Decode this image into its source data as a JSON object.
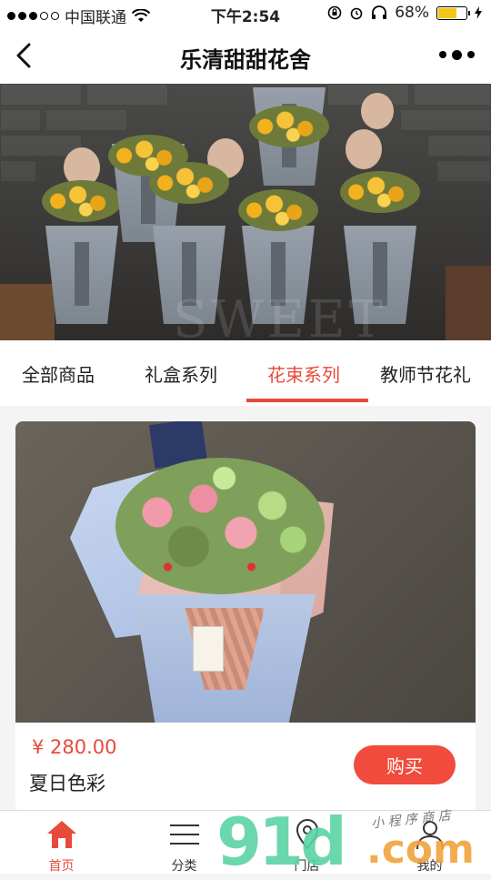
{
  "status_bar": {
    "carrier": "中国联通",
    "time": "下午2:54",
    "battery": "68%",
    "battery_level": 0.68
  },
  "nav": {
    "title": "乐清甜甜花舍"
  },
  "banner": {
    "watermark": "SWEET"
  },
  "tabs": [
    {
      "label": "全部商品",
      "active": false
    },
    {
      "label": "礼盒系列",
      "active": false
    },
    {
      "label": "花束系列",
      "active": true
    },
    {
      "label": "教师节花礼",
      "active": false
    }
  ],
  "product": {
    "price": "¥ 280.00",
    "name": "夏日色彩",
    "buy_label": "购买"
  },
  "tabbar": [
    {
      "label": "首页",
      "icon": "home-icon",
      "active": true
    },
    {
      "label": "分类",
      "icon": "menu-icon",
      "active": false
    },
    {
      "label": "门店",
      "icon": "location-icon",
      "active": false
    },
    {
      "label": "我的",
      "icon": "user-icon",
      "active": false
    }
  ],
  "watermark_logo": {
    "text_main": "91",
    "text_d": "d",
    "text_com": ".com",
    "script": "小 程 序 商 店"
  },
  "colors": {
    "accent": "#e84a3a",
    "buy_button": "#f04b3c",
    "battery": "#f5c518"
  }
}
